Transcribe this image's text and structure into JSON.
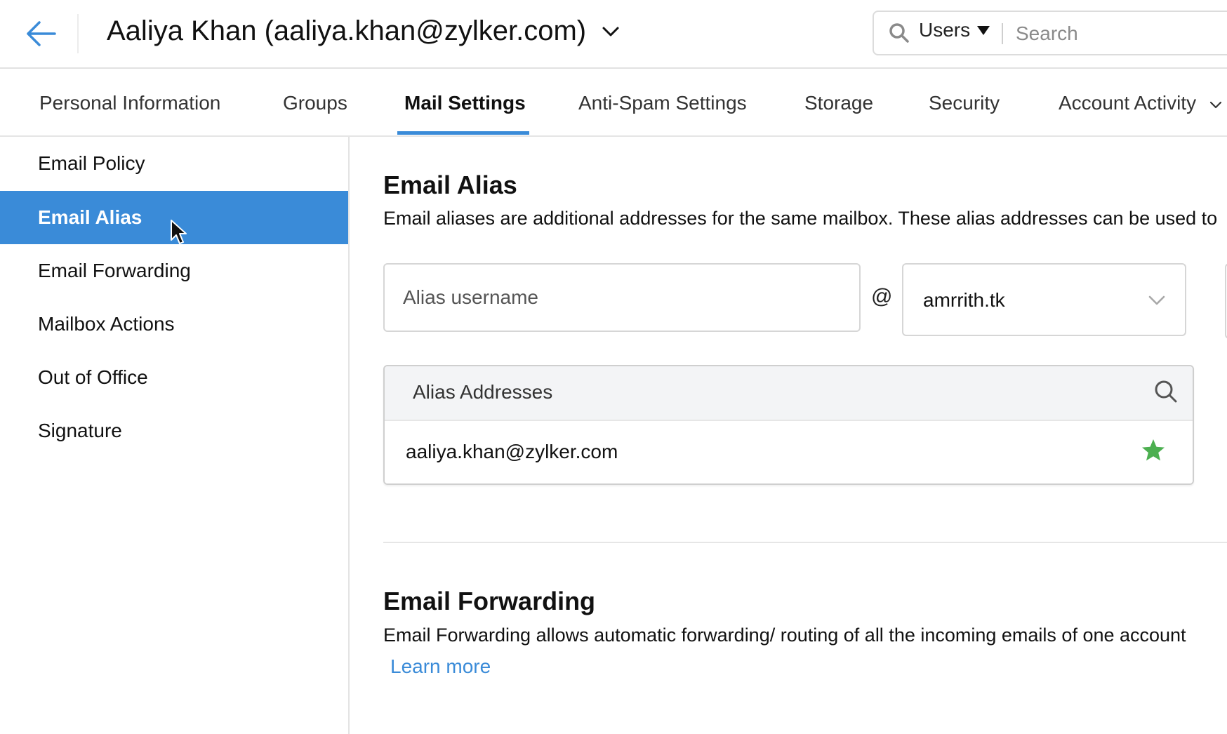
{
  "header": {
    "title": "Aaliya Khan (aaliya.khan@zylker.com)",
    "search": {
      "scope": "Users",
      "placeholder": "Search",
      "value": ""
    }
  },
  "tabs": [
    {
      "label": "Personal Information",
      "active": false
    },
    {
      "label": "Groups",
      "active": false
    },
    {
      "label": "Mail Settings",
      "active": true
    },
    {
      "label": "Anti-Spam Settings",
      "active": false
    },
    {
      "label": "Storage",
      "active": false
    },
    {
      "label": "Security",
      "active": false
    },
    {
      "label": "Account Activity",
      "active": false
    }
  ],
  "sidebar": {
    "items": [
      {
        "label": "Email Policy",
        "active": false
      },
      {
        "label": "Email Alias",
        "active": true
      },
      {
        "label": "Email Forwarding",
        "active": false
      },
      {
        "label": "Mailbox Actions",
        "active": false
      },
      {
        "label": "Out of Office",
        "active": false
      },
      {
        "label": "Signature",
        "active": false
      }
    ]
  },
  "email_alias": {
    "title": "Email Alias",
    "description": "Email aliases are additional addresses for the same mailbox. These alias addresses can be used to",
    "username_placeholder": "Alias username",
    "username_value": "",
    "at_symbol": "@",
    "domain_selected": "amrrith.tk",
    "table": {
      "header": "Alias Addresses",
      "rows": [
        {
          "address": "aaliya.khan@zylker.com",
          "primary": true
        }
      ]
    }
  },
  "email_forwarding": {
    "title": "Email Forwarding",
    "description": "Email Forwarding allows automatic forwarding/ routing of all the incoming emails of one account",
    "learn_more": "Learn more"
  },
  "colors": {
    "accent": "#3a8bd8",
    "primary_star": "#4caf50",
    "table_header_bg": "#f3f4f6"
  }
}
